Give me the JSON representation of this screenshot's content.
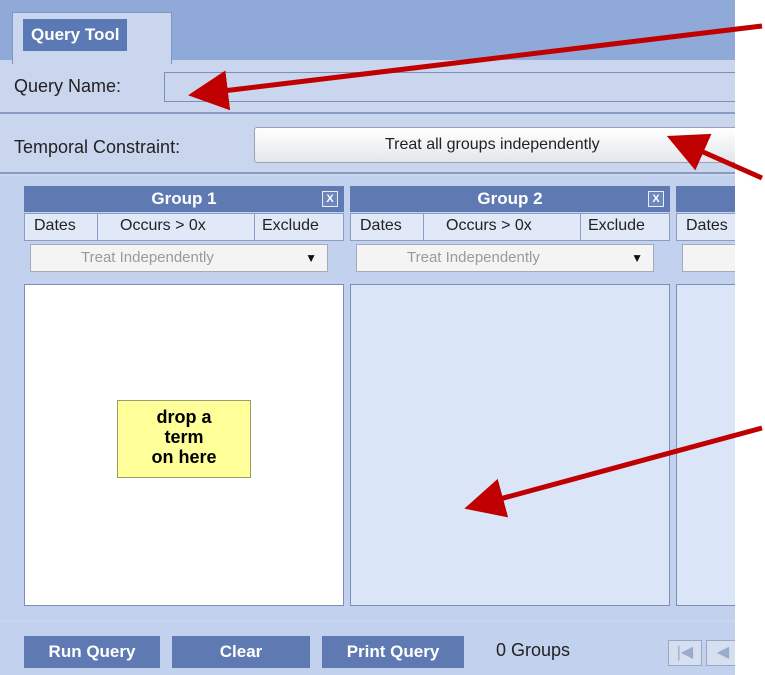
{
  "tab": {
    "label": "Query Tool"
  },
  "query_name": {
    "label": "Query Name:",
    "value": ""
  },
  "temporal": {
    "label": "Temporal Constraint:",
    "value": "Treat all groups independently"
  },
  "group_options": {
    "dates": "Dates",
    "occurs": "Occurs > 0x",
    "exclude": "Exclude",
    "select_value": "Treat Independently"
  },
  "groups": [
    {
      "title": "Group 1",
      "close": "X"
    },
    {
      "title": "Group 2",
      "close": "X"
    }
  ],
  "drop_hint": "drop a\nterm\non here",
  "footer": {
    "run": "Run Query",
    "clear": "Clear",
    "print": "Print Query",
    "count": "0 Groups"
  },
  "colors": {
    "accent": "#5f7ab2",
    "annotation_arrow": "#c00000",
    "hint_background": "#ffff99"
  }
}
